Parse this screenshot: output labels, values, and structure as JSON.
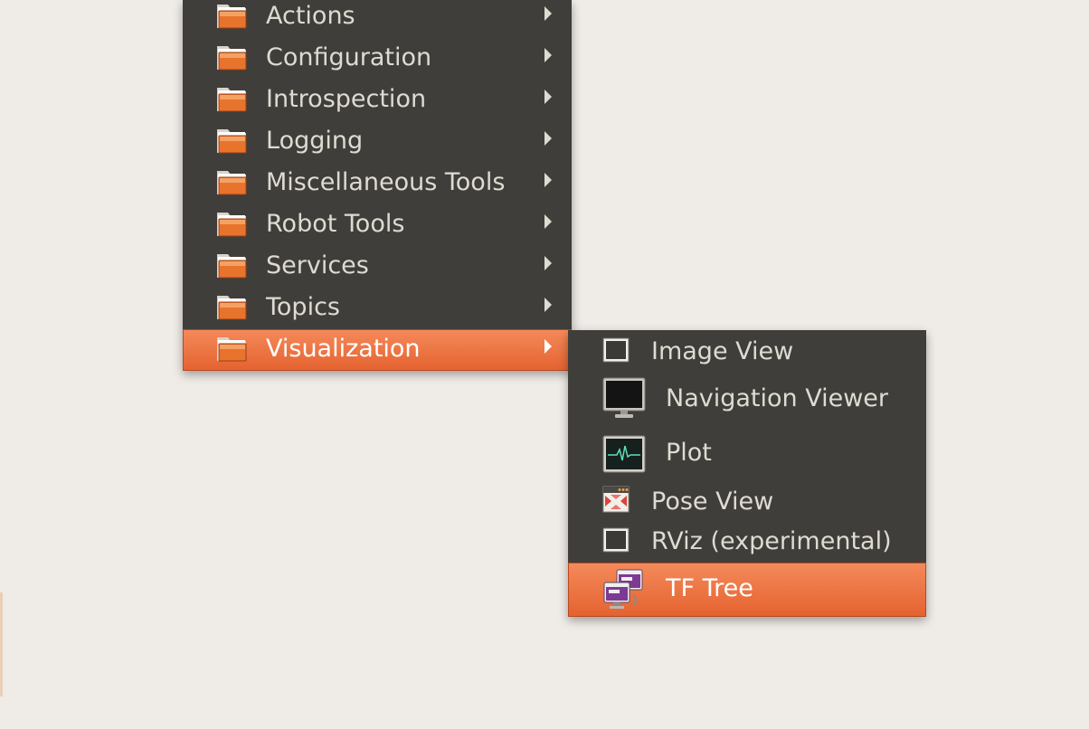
{
  "colors": {
    "menu_background": "#3f3e3a",
    "highlight": "#f27a49",
    "text": "#dfdbd2",
    "desktop": "#efebe7"
  },
  "main_menu": {
    "items": [
      {
        "label": "Actions",
        "icon": "folder-icon",
        "has_submenu": true
      },
      {
        "label": "Configuration",
        "icon": "folder-icon",
        "has_submenu": true
      },
      {
        "label": "Introspection",
        "icon": "folder-icon",
        "has_submenu": true
      },
      {
        "label": "Logging",
        "icon": "folder-icon",
        "has_submenu": true
      },
      {
        "label": "Miscellaneous Tools",
        "icon": "folder-icon",
        "has_submenu": true
      },
      {
        "label": "Robot Tools",
        "icon": "folder-icon",
        "has_submenu": true
      },
      {
        "label": "Services",
        "icon": "folder-icon",
        "has_submenu": true
      },
      {
        "label": "Topics",
        "icon": "folder-icon",
        "has_submenu": true
      },
      {
        "label": "Visualization",
        "icon": "folder-icon",
        "has_submenu": true,
        "active": true
      }
    ]
  },
  "submenu": {
    "items": [
      {
        "label": "Image View",
        "icon": "window-frame-icon"
      },
      {
        "label": "Navigation Viewer",
        "icon": "monitor-icon"
      },
      {
        "label": "Plot",
        "icon": "plot-monitor-icon"
      },
      {
        "label": "Pose View",
        "icon": "pose-view-icon"
      },
      {
        "label": "RViz (experimental)",
        "icon": "window-frame-icon"
      },
      {
        "label": "TF Tree",
        "icon": "tf-tree-icon",
        "active": true
      }
    ]
  }
}
